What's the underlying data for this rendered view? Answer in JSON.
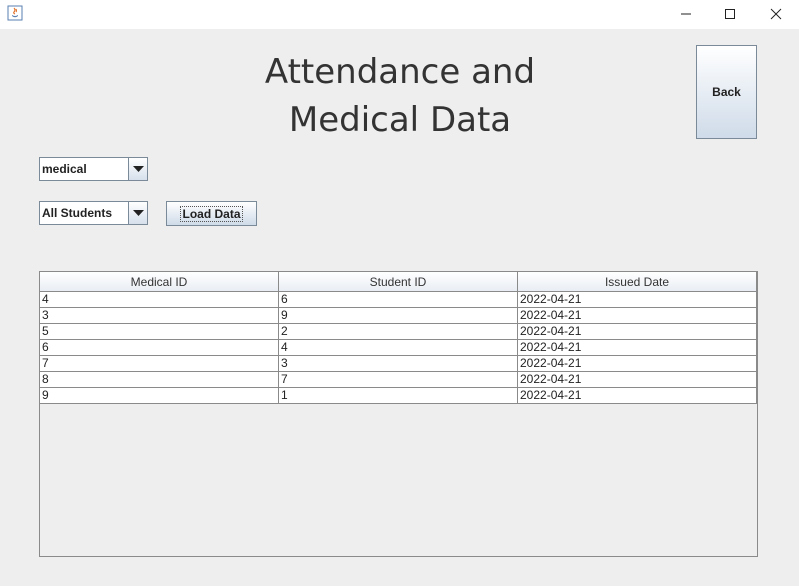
{
  "window": {
    "icon": "java-icon",
    "controls": [
      "minimize-icon",
      "maximize-icon",
      "close-icon"
    ]
  },
  "heading": {
    "line1": "Attendance and",
    "line2": "Medical Data"
  },
  "back_button": {
    "label": "Back"
  },
  "type_select": {
    "value": "medical"
  },
  "student_select": {
    "value": "All Students"
  },
  "load_button": {
    "label": "Load Data"
  },
  "table": {
    "columns": [
      "Medical ID",
      "Student ID",
      "Issued Date"
    ],
    "rows": [
      [
        "4",
        "6",
        "2022-04-21"
      ],
      [
        "3",
        "9",
        "2022-04-21"
      ],
      [
        "5",
        "2",
        "2022-04-21"
      ],
      [
        "6",
        "4",
        "2022-04-21"
      ],
      [
        "7",
        "3",
        "2022-04-21"
      ],
      [
        "8",
        "7",
        "2022-04-21"
      ],
      [
        "9",
        "1",
        "2022-04-21"
      ]
    ]
  }
}
